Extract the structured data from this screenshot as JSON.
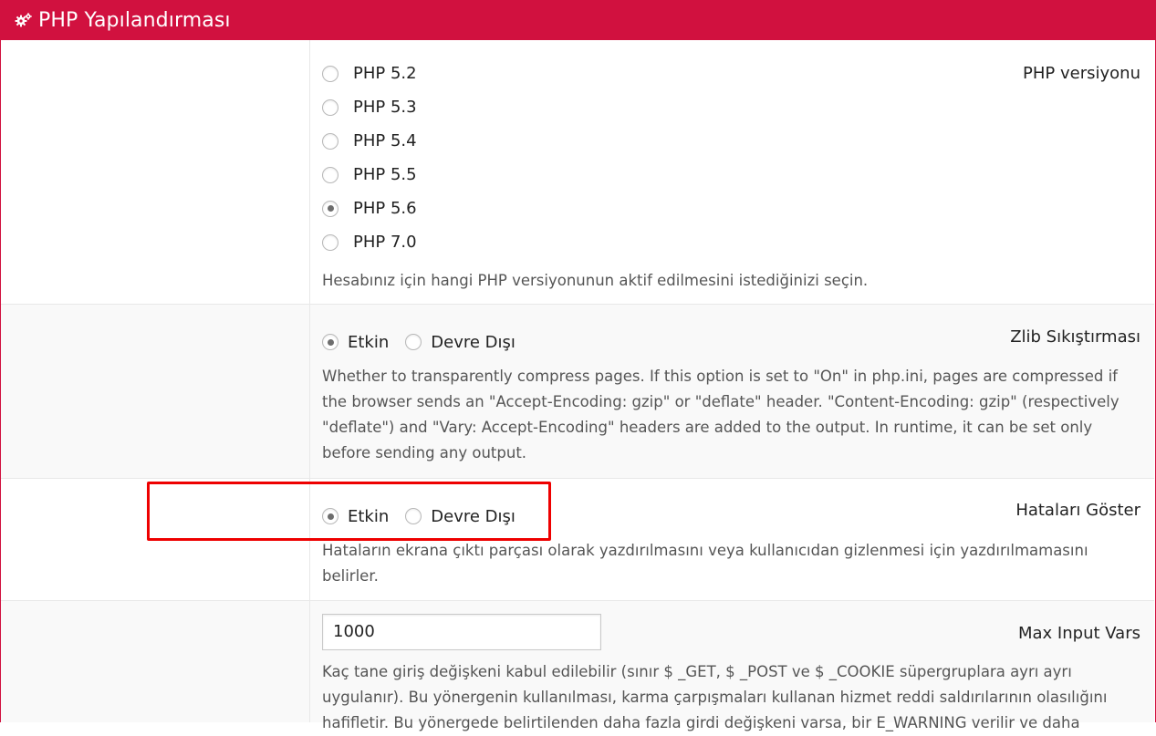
{
  "header": {
    "title": "PHP Yapılandırması",
    "icon": "gears-icon"
  },
  "php_version": {
    "label": "PHP versiyonu",
    "options": [
      "PHP 5.2",
      "PHP 5.3",
      "PHP 5.4",
      "PHP 5.5",
      "PHP 5.6",
      "PHP 7.0"
    ],
    "selected": "PHP 5.6",
    "help": "Hesabınız için hangi PHP versiyonunun aktif edilmesini istediğinizi seçin."
  },
  "zlib": {
    "label": "Zlib Sıkıştırması",
    "enabled_label": "Etkin",
    "disabled_label": "Devre Dışı",
    "selected": "Etkin",
    "help_lines": [
      "Whether to transparently compress pages. If this option is set to \"On\" in php.ini, pages are compressed if",
      "the browser sends an \"Accept-Encoding: gzip\" or \"deflate\" header. \"Content-Encoding: gzip\" (respectively",
      "\"deflate\") and \"Vary: Accept-Encoding\" headers are added to the output. In runtime, it can be set only",
      "before sending any output."
    ]
  },
  "display_errors": {
    "label": "Hataları Göster",
    "enabled_label": "Etkin",
    "disabled_label": "Devre Dışı",
    "selected": "Etkin",
    "help_lines": [
      "Hataların ekrana çıktı parçası olarak yazdırılmasını veya kullanıcıdan gizlenmesi için yazdırılmamasını",
      "belirler."
    ]
  },
  "max_input_vars": {
    "label": "Max Input Vars",
    "value": "1000",
    "help_lines": [
      "Kaç tane giriş değişkeni kabul edilebilir (sınır $ _GET, $ _POST ve $ _COOKIE süpergruplara ayrı ayrı",
      "uygulanır). Bu yönergenin kullanılması, karma çarpışmaları kullanan hizmet reddi saldırılarının olasılığını",
      "hafifletir. Bu yönergede belirtilenden daha fazla girdi değişkeni varsa, bir E_WARNING verilir ve daha"
    ]
  },
  "colors": {
    "brand": "#d1113f",
    "highlight": "#ee0000"
  }
}
